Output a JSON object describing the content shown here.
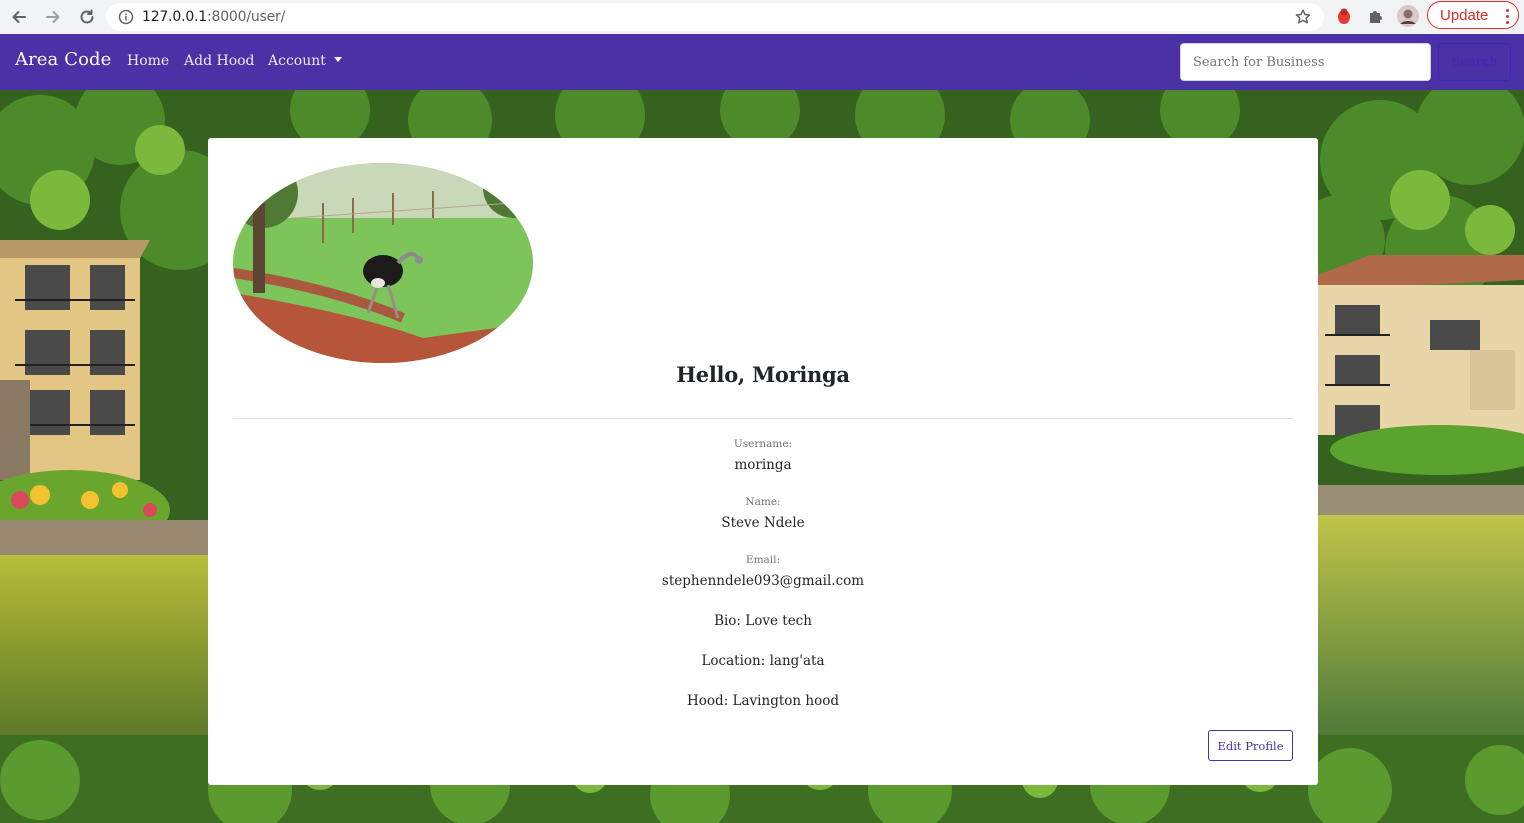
{
  "browser": {
    "url_host": "127.0.0.1",
    "url_path": ":8000/user/",
    "update_label": "Update"
  },
  "navbar": {
    "brand": "Area Code",
    "links": [
      "Home",
      "Add Hood",
      "Account"
    ],
    "search_placeholder": "Search for Business",
    "search_button": "Search",
    "color": "#4a32a6"
  },
  "profile": {
    "greeting": "Hello, Moringa",
    "username_label": "Username:",
    "username": "moringa",
    "name_label": "Name:",
    "name": "Steve Ndele",
    "email_label": "Email:",
    "email": "stephenndele093@gmail.com",
    "bio": "Bio: Love tech",
    "location": "Location: lang'ata",
    "hood": "Hood: Lavington hood",
    "edit_button": "Edit Profile"
  }
}
